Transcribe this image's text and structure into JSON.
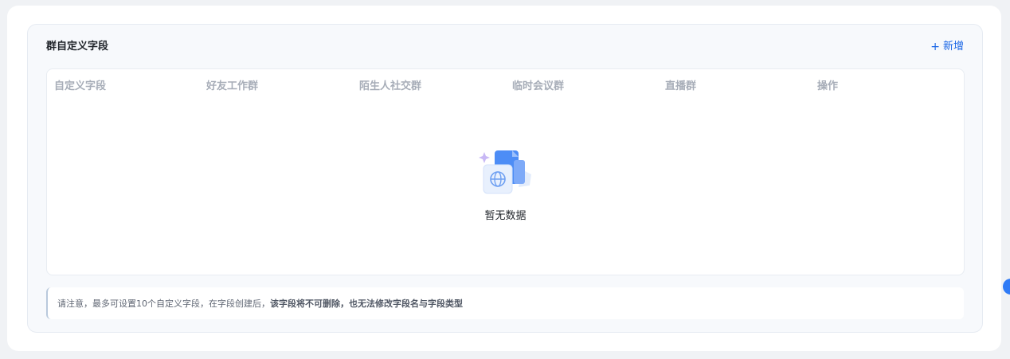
{
  "section": {
    "title": "群自定义字段",
    "add_label": "新增",
    "add_icon": "plus-icon"
  },
  "table": {
    "columns": [
      "自定义字段",
      "好友工作群",
      "陌生人社交群",
      "临时会议群",
      "直播群",
      "操作"
    ],
    "rows": [],
    "empty_text": "暂无数据",
    "empty_icon": "empty-document-globe-illustration"
  },
  "notice": {
    "text": "请注意，最多可设置10个自定义字段，在字段创建后，",
    "emphasis": "该字段将不可删除，也无法修改字段名与字段类型"
  },
  "colors": {
    "accent": "#1a66e6",
    "header_text": "#a7adb8",
    "panel_bg": "#f7f9fc"
  }
}
